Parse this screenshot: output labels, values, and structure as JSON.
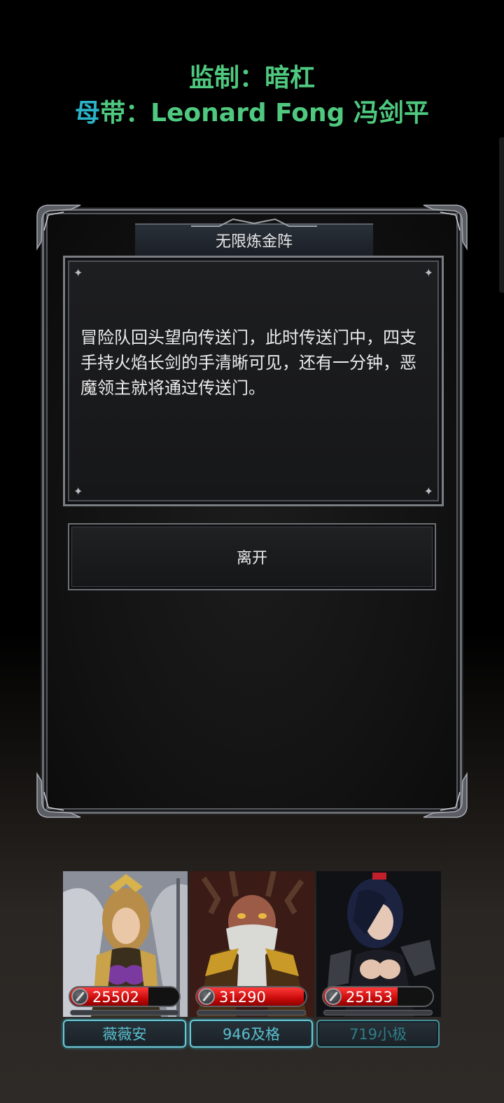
{
  "credits": {
    "line1": "监制：暗杠",
    "line2_prefix": "母",
    "line2_rest": "带：Leonard Fong 冯剑平"
  },
  "dialog": {
    "title": "无限炼金阵",
    "story": "冒险队回头望向传送门，此时传送门中，四支手持火焰长剑的手清晰可见，还有一分钟，恶魔领主就将通过传送门。",
    "leave_button": "离开"
  },
  "party": [
    {
      "name": "薇薇安",
      "hp": "25502",
      "hp_fill": 0.72
    },
    {
      "name": "946及格",
      "hp": "31290",
      "hp_fill": 0.98
    },
    {
      "name": "719小极",
      "hp": "25153",
      "hp_fill": 0.68
    }
  ],
  "colors": {
    "credit_green": "#4fc97f",
    "credit_cyan": "#2bb3c9",
    "hp_red": "#d41010",
    "name_cyan": "#58c0d0"
  }
}
